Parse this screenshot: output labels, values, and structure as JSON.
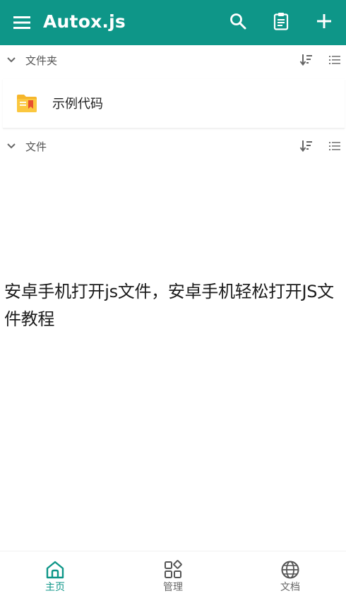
{
  "app": {
    "title": "Autox.js",
    "accent_color": "#0e9688",
    "icons": [
      "menu-icon",
      "search-icon",
      "clipboard-icon",
      "add-icon"
    ]
  },
  "sections": {
    "folders": {
      "label": "文件夹",
      "icons": [
        "chevron-down-icon",
        "sort-icon",
        "list-view-icon"
      ]
    },
    "files": {
      "label": "文件",
      "icons": [
        "chevron-down-icon",
        "sort-icon",
        "list-view-icon"
      ]
    }
  },
  "folders": [
    {
      "name": "示例代码",
      "icon": "folder-icon"
    }
  ],
  "overlay": {
    "text": "安卓手机打开js文件，安卓手机轻松打开JS文件教程"
  },
  "bottom_nav": {
    "items": [
      {
        "label": "主页",
        "icon": "home-icon",
        "active": true
      },
      {
        "label": "管理",
        "icon": "grid-icon",
        "active": false
      },
      {
        "label": "文档",
        "icon": "globe-icon",
        "active": false
      }
    ]
  }
}
